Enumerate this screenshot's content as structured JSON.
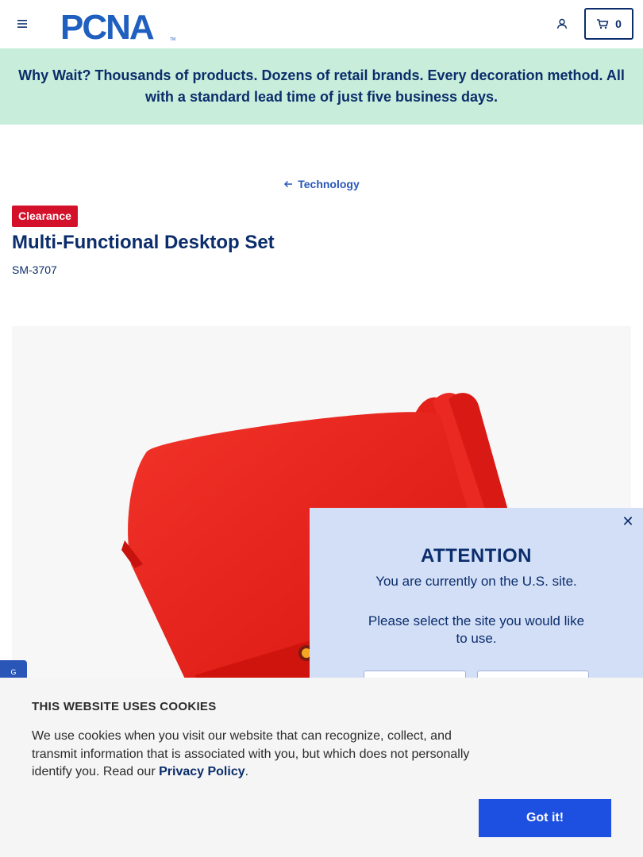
{
  "header": {
    "logo_text": "PCNA",
    "logo_trademark": "TM",
    "cart_count": "0"
  },
  "promo": {
    "text": "Why Wait? Thousands of products. Dozens of retail brands. Every decoration method. All with a standard lead time of just five business days."
  },
  "breadcrumb": {
    "label": "Technology"
  },
  "product": {
    "badge": "Clearance",
    "title": "Multi-Functional Desktop Set",
    "sku": "SM-3707",
    "image_color": "#e8231d"
  },
  "side_tab": {
    "label": "G"
  },
  "attention": {
    "heading": "ATTENTION",
    "line1": "You are currently on the U.S. site.",
    "line2": "Please select the site you would like to use."
  },
  "cookie": {
    "title": "THIS WEBSITE USES COOKIES",
    "text_before": "We use cookies when you visit our website that can recognize, collect, and transmit information that is associated with you, but which does not personally identify you. Read our ",
    "link": "Privacy Policy",
    "text_after": ".",
    "button": "Got it!"
  },
  "colors": {
    "brand_navy": "#0b2d6b",
    "promo_bg": "#c8eedb",
    "badge_red": "#d3112a",
    "cta_blue": "#1d4fe0",
    "modal_bg": "#d3dff7"
  }
}
